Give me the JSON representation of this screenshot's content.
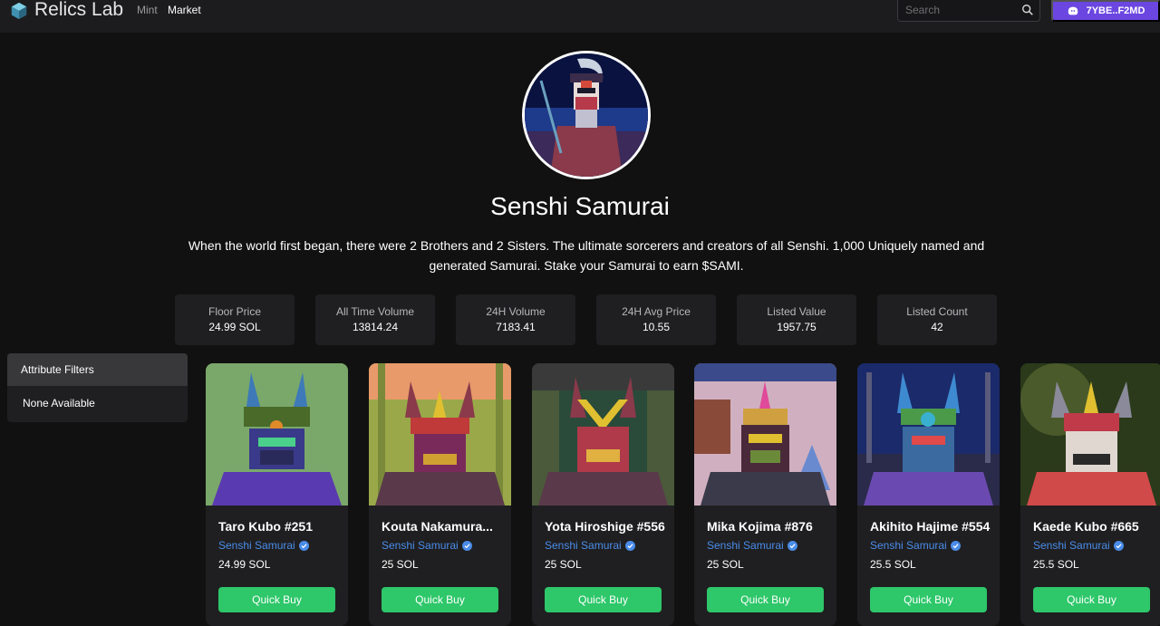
{
  "header": {
    "brand": "Relics Lab",
    "nav": {
      "mint": "Mint",
      "market": "Market"
    },
    "search_placeholder": "Search",
    "wallet_label": "7YBE..F2MD"
  },
  "collection": {
    "name": "Senshi Samurai",
    "description": "When the world first began, there were 2 Brothers and 2 Sisters. The ultimate sorcerers and creators of all Senshi. 1,000 Uniquely named and generated Samurai. Stake your Samurai to earn $SAMI."
  },
  "stats": [
    {
      "label": "Floor Price",
      "value": "24.99 SOL"
    },
    {
      "label": "All Time Volume",
      "value": "13814.24"
    },
    {
      "label": "24H Volume",
      "value": "7183.41"
    },
    {
      "label": "24H Avg Price",
      "value": "10.55"
    },
    {
      "label": "Listed Value",
      "value": "1957.75"
    },
    {
      "label": "Listed Count",
      "value": "42"
    }
  ],
  "filters": {
    "title": "Attribute Filters",
    "empty": "None Available"
  },
  "listings": [
    {
      "name": "Taro Kubo #251",
      "collection": "Senshi Samurai",
      "price": "24.99 SOL",
      "button": "Quick Buy"
    },
    {
      "name": "Kouta Nakamura...",
      "collection": "Senshi Samurai",
      "price": "25 SOL",
      "button": "Quick Buy"
    },
    {
      "name": "Yota Hiroshige #556",
      "collection": "Senshi Samurai",
      "price": "25 SOL",
      "button": "Quick Buy"
    },
    {
      "name": "Mika Kojima #876",
      "collection": "Senshi Samurai",
      "price": "25 SOL",
      "button": "Quick Buy"
    },
    {
      "name": "Akihito Hajime #554",
      "collection": "Senshi Samurai",
      "price": "25.5 SOL",
      "button": "Quick Buy"
    },
    {
      "name": "Kaede Kubo #665",
      "collection": "Senshi Samurai",
      "price": "25.5 SOL",
      "button": "Quick Buy"
    }
  ],
  "colors": {
    "background": "#111111",
    "panel": "#1f1f21",
    "accent_purple": "#6b46e0",
    "buy_green": "#2ec76a",
    "link_blue": "#4a8ce8"
  }
}
